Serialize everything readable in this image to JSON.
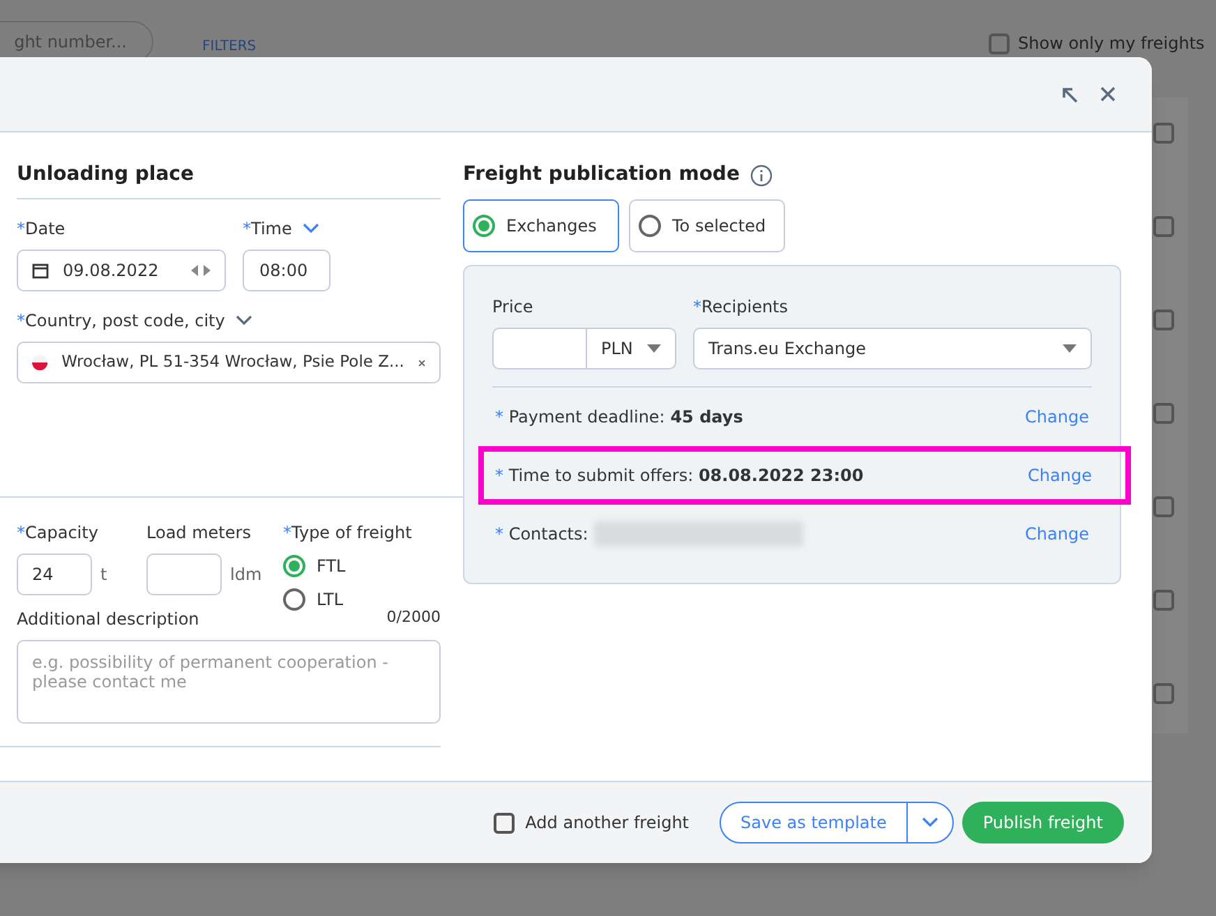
{
  "background": {
    "search_placeholder": "ght number...",
    "filters": "FILTERS",
    "only_mine": {
      "label": "Show only my freights",
      "checked": false
    },
    "rows": [
      {
        "checked": false
      },
      {
        "checked": false
      },
      {
        "checked": false
      },
      {
        "checked": false
      },
      {
        "checked": false
      },
      {
        "checked": false
      },
      {
        "checked": false
      }
    ]
  },
  "unloading": {
    "title": "Unloading place",
    "date": {
      "mark": "*",
      "label": "Date",
      "value": "09.08.2022"
    },
    "time": {
      "mark": "*",
      "label": "Time",
      "value": "08:00"
    },
    "location": {
      "mark": "*",
      "label": "Country, post code, city",
      "value": "Wrocław, PL 51-354 Wrocław, Psie Pole Z..."
    },
    "capacity": {
      "mark": "*",
      "label": "Capacity",
      "value": "24",
      "unit": "t"
    },
    "load_meters": {
      "label": "Load meters",
      "unit": "ldm"
    },
    "freight_type": {
      "mark": "*",
      "label": "Type of freight",
      "options": [
        {
          "label": "FTL",
          "selected": true
        },
        {
          "label": "LTL",
          "selected": false
        }
      ]
    },
    "description": {
      "label": "Additional description",
      "counter": "0/2000",
      "placeholder": "e.g. possibility of permanent cooperation - please contact me"
    }
  },
  "publication": {
    "title": "Freight publication mode",
    "modes": [
      {
        "label": "Exchanges",
        "selected": true
      },
      {
        "label": "To selected",
        "selected": false
      }
    ],
    "price": {
      "label": "Price",
      "currency": "PLN"
    },
    "recipients": {
      "mark": "*",
      "label": "Recipients",
      "value": "Trans.eu Exchange"
    },
    "terms": [
      {
        "mark": "*",
        "label": "Payment deadline:",
        "value": "45 days",
        "action": "Change",
        "highlighted": false
      },
      {
        "mark": "*",
        "label": "Time to submit offers:",
        "value": "08.08.2022 23:00",
        "action": "Change",
        "highlighted": true
      },
      {
        "mark": "*",
        "label": "Contacts:",
        "action": "Change",
        "highlighted": false
      }
    ]
  },
  "footer": {
    "add_another": {
      "label": "Add another freight",
      "checked": false
    },
    "save_template": "Save as template",
    "publish": "Publish freight"
  }
}
